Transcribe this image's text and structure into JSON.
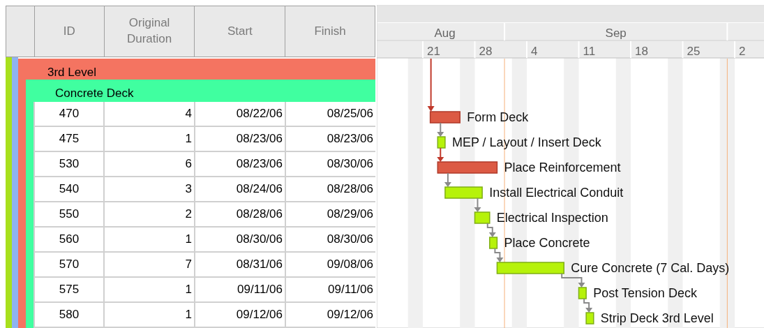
{
  "grid": {
    "columns": [
      "ID",
      "Original Duration",
      "Start",
      "Finish"
    ]
  },
  "outer_bands": [
    {
      "color": "#a8e01c"
    },
    {
      "color": "#8fb3f0"
    }
  ],
  "wbs": {
    "name": "3rd Level",
    "color": "#f47461",
    "children": [
      {
        "name": "Concrete Deck",
        "color": "#40ffa0",
        "activities": [
          {
            "id": "470",
            "duration": "4",
            "start": "08/22/06",
            "finish": "08/25/06",
            "name": "Form Deck",
            "critical": true
          },
          {
            "id": "475",
            "duration": "1",
            "start": "08/23/06",
            "finish": "08/23/06",
            "name": "MEP / Layout / Insert Deck",
            "critical": false
          },
          {
            "id": "530",
            "duration": "6",
            "start": "08/23/06",
            "finish": "08/30/06",
            "name": "Place Reinforcement",
            "critical": true
          },
          {
            "id": "540",
            "duration": "3",
            "start": "08/24/06",
            "finish": "08/28/06",
            "name": "Install Electrical Conduit",
            "critical": false
          },
          {
            "id": "550",
            "duration": "2",
            "start": "08/28/06",
            "finish": "08/29/06",
            "name": "Electrical Inspection",
            "critical": false
          },
          {
            "id": "560",
            "duration": "1",
            "start": "08/30/06",
            "finish": "08/30/06",
            "name": "Place Concrete",
            "critical": false
          },
          {
            "id": "570",
            "duration": "7",
            "start": "08/31/06",
            "finish": "09/08/06",
            "name": "Cure Concrete (7 Cal. Days)",
            "critical": false
          },
          {
            "id": "575",
            "duration": "1",
            "start": "09/11/06",
            "finish": "09/11/06",
            "name": "Post Tension Deck",
            "critical": false
          },
          {
            "id": "580",
            "duration": "1",
            "start": "09/12/06",
            "finish": "09/12/06",
            "name": "Strip Deck 3rd Level",
            "critical": false
          }
        ]
      }
    ]
  },
  "timescale": {
    "months": [
      "Aug",
      "Sep"
    ],
    "weeks": [
      "21",
      "28",
      "4",
      "11",
      "18",
      "25",
      "2"
    ]
  }
}
